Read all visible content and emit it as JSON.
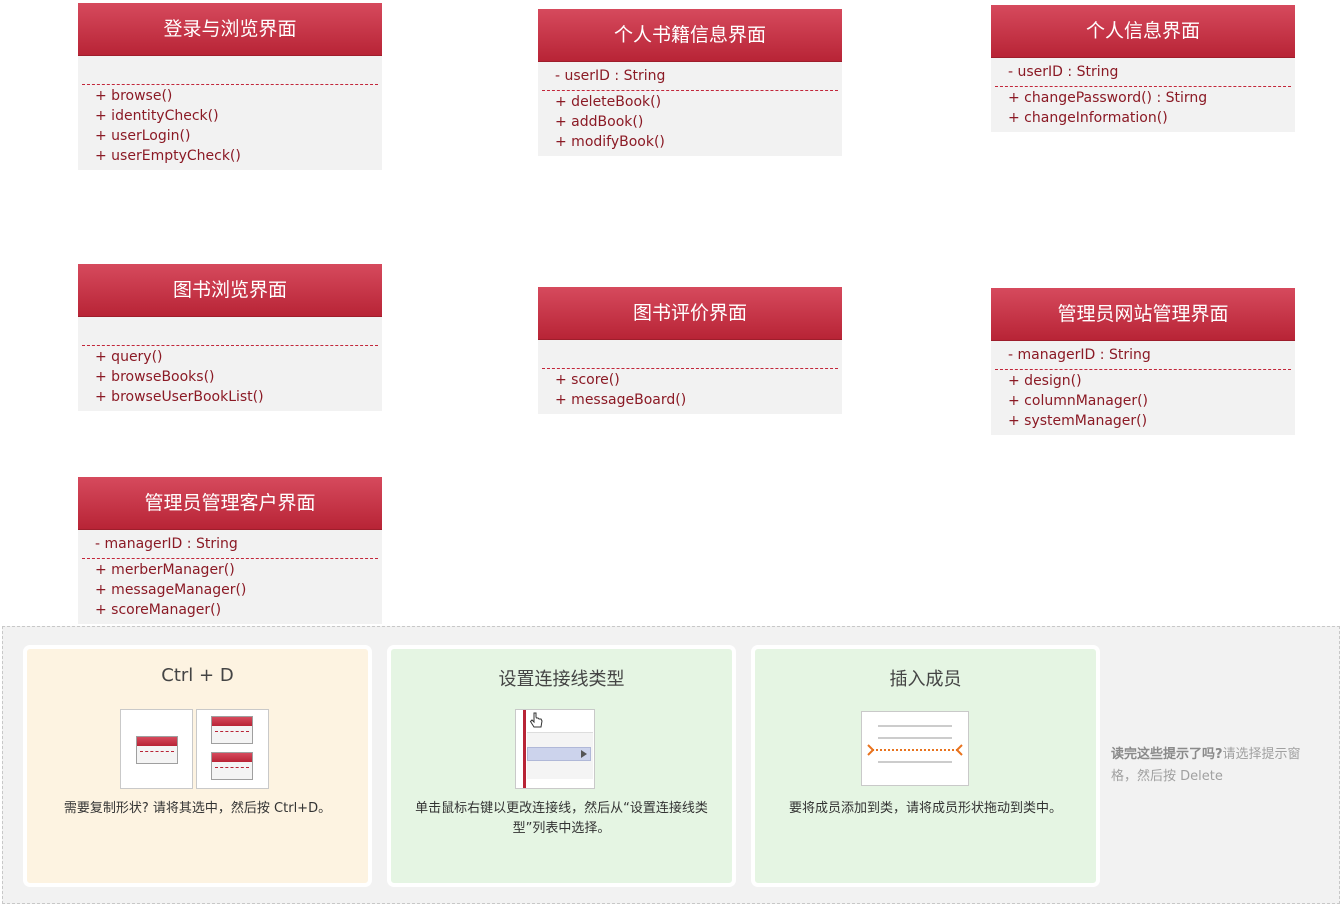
{
  "classes": [
    {
      "title": "登录与浏览界面",
      "attributes": [],
      "operations": [
        "+  browse()",
        "+ identityCheck()",
        "+ userLogin()",
        "+ userEmptyCheck()"
      ]
    },
    {
      "title": "个人书籍信息界面",
      "attributes": [
        "- userID : String"
      ],
      "operations": [
        "+ deleteBook()",
        "+ addBook()",
        "+ modifyBook()"
      ]
    },
    {
      "title": "个人信息界面",
      "attributes": [
        "- userID : String"
      ],
      "operations": [
        "+ changePassword() : Stirng",
        "+ changeInformation()"
      ]
    },
    {
      "title": "图书浏览界面",
      "attributes": [],
      "operations": [
        "+ query()",
        "+ browseBooks()",
        "+ browseUserBookList()"
      ]
    },
    {
      "title": "图书评价界面",
      "attributes": [],
      "operations": [
        "+ score()",
        "+ messageBoard()"
      ]
    },
    {
      "title": "管理员网站管理界面",
      "attributes": [
        "- managerID : String"
      ],
      "operations": [
        "+ design()",
        "+ columnManager()",
        "+ systemManager()"
      ]
    },
    {
      "title": "管理员管理客户界面",
      "attributes": [
        "- managerID : String"
      ],
      "operations": [
        "+ merberManager()",
        "+ messageManager()",
        "+ scoreManager()"
      ]
    }
  ],
  "hints": {
    "cards": [
      {
        "title": "Ctrl + D",
        "description": "需要复制形状? 请将其选中，然后按 Ctrl+D。",
        "background": "#fdf3e1"
      },
      {
        "title": "设置连接线类型",
        "description": "单击鼠标右键以更改连接线，然后从“设置连接线类型”列表中选择。",
        "background": "#e5f5e3"
      },
      {
        "title": "插入成员",
        "description": "要将成员添加到类，请将成员形状拖动到类中。",
        "background": "#e5f5e3"
      }
    ],
    "side_note_bold": "读完这些提示了吗?",
    "side_note_rest": "请选择提示窗格，然后按 Delete"
  },
  "icons": {
    "cursor": "hand-cursor-icon",
    "dropdown_arrow": "triangle-right-icon",
    "member_drag": "member-drag-icon"
  },
  "colors": {
    "header_top": "#d64a5d",
    "header_bottom": "#b82436",
    "member_text": "#8b1a25",
    "class_body": "#f2f2f2",
    "member_accent": "#e8731e"
  }
}
